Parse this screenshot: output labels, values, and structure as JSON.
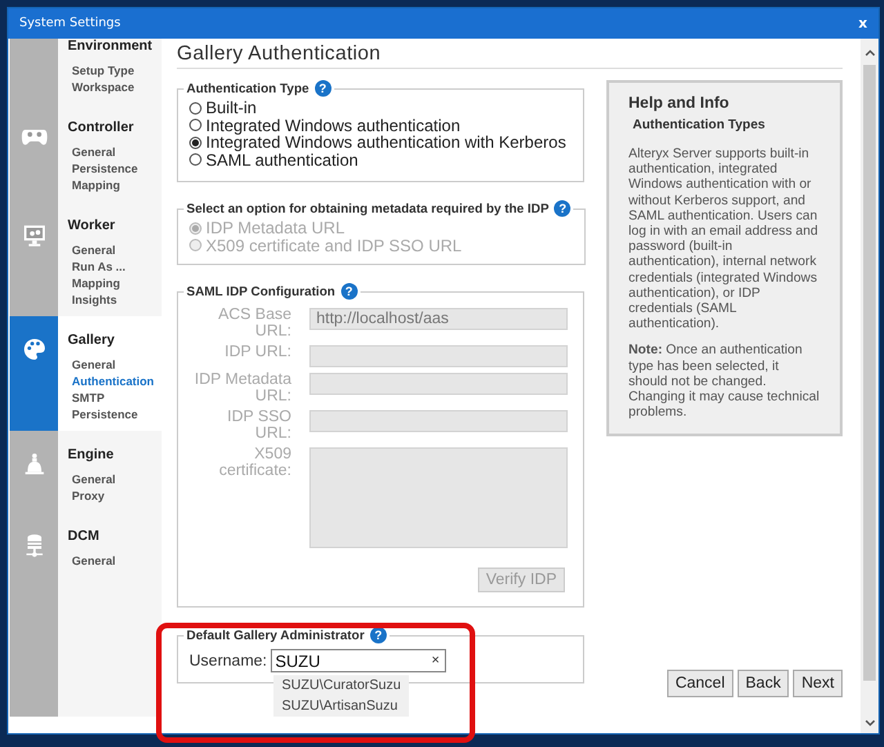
{
  "window": {
    "title": "System Settings",
    "close": "x"
  },
  "sidebar": {
    "sections": [
      {
        "title": "Environment",
        "selected": false,
        "items": [
          {
            "label": "Setup Type",
            "selected": false
          },
          {
            "label": "Workspace",
            "selected": false
          }
        ]
      },
      {
        "title": "Controller",
        "selected": false,
        "items": [
          {
            "label": "General",
            "selected": false
          },
          {
            "label": "Persistence",
            "selected": false
          },
          {
            "label": "Mapping",
            "selected": false
          }
        ]
      },
      {
        "title": "Worker",
        "selected": false,
        "items": [
          {
            "label": "General",
            "selected": false
          },
          {
            "label": "Run As ...",
            "selected": false
          },
          {
            "label": "Mapping",
            "selected": false
          },
          {
            "label": "Insights",
            "selected": false
          }
        ]
      },
      {
        "title": "Gallery",
        "selected": true,
        "items": [
          {
            "label": "General",
            "selected": false
          },
          {
            "label": "Authentication",
            "selected": true
          },
          {
            "label": "SMTP",
            "selected": false
          },
          {
            "label": "Persistence",
            "selected": false
          }
        ]
      },
      {
        "title": "Engine",
        "selected": false,
        "items": [
          {
            "label": "General",
            "selected": false
          },
          {
            "label": "Proxy",
            "selected": false
          }
        ]
      },
      {
        "title": "DCM",
        "selected": false,
        "items": [
          {
            "label": "General",
            "selected": false
          }
        ]
      }
    ]
  },
  "page": {
    "title": "Gallery Authentication"
  },
  "auth_type": {
    "legend": "Authentication Type",
    "help": "?",
    "options": [
      {
        "label": "Built-in",
        "selected": false
      },
      {
        "label": "Integrated Windows authentication",
        "selected": false
      },
      {
        "label": "Integrated Windows authentication with Kerberos",
        "selected": true
      },
      {
        "label": "SAML authentication",
        "selected": false
      }
    ]
  },
  "metadata": {
    "legend": "Select an option for obtaining metadata required by the IDP",
    "help": "?",
    "disabled": true,
    "options": [
      {
        "label": "IDP Metadata URL",
        "selected": true
      },
      {
        "label": "X509 certificate and IDP SSO URL",
        "selected": false
      }
    ]
  },
  "saml": {
    "legend": "SAML IDP Configuration",
    "help": "?",
    "fields": [
      {
        "kind": "text",
        "label": "ACS Base URL:",
        "value": "http://localhost/aas",
        "disabled": true
      },
      {
        "kind": "text",
        "label": "IDP URL:",
        "disabled": true
      },
      {
        "kind": "text",
        "label": "IDP Metadata URL:",
        "disabled": true
      },
      {
        "kind": "text",
        "label": "IDP SSO URL:",
        "disabled": true
      },
      {
        "kind": "textarea",
        "label": "X509 certificate:",
        "disabled": true
      }
    ],
    "verify_button": {
      "label": "Verify IDP",
      "disabled": true
    }
  },
  "admin": {
    "legend": "Default Gallery Administrator",
    "help": "?",
    "label": "Username:",
    "value": "SUZU",
    "clear": "×",
    "suggestions": [
      "SUZU\\CuratorSuzu",
      "SUZU\\ArtisanSuzu"
    ]
  },
  "help": {
    "title": "Help and Info",
    "subtitle": "Authentication Types",
    "paragraphs": [
      "Alteryx Server supports built-in authentication, integrated Windows authentication with or without Kerberos support, and SAML authentication. Users can log in with an email address and password (built-in authentication), internal network credentials (integrated Windows authentication), or IDP credentials (SAML authentication).",
      "**Note:** Once an authentication type has been selected, it should not be changed. Changing it may cause technical problems."
    ]
  },
  "buttons": [
    "Cancel",
    "Back",
    "Next"
  ],
  "annotation": {
    "kind": "frame"
  }
}
